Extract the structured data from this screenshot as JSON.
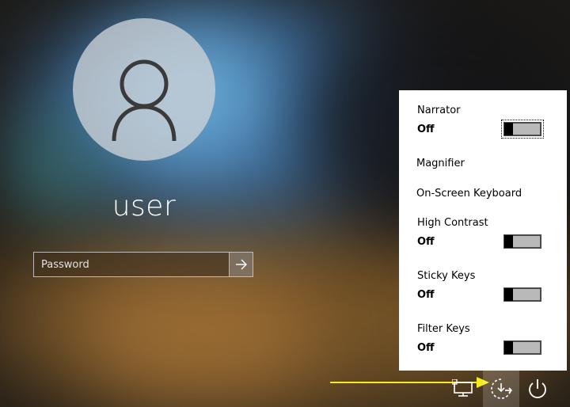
{
  "login": {
    "user_name": "user",
    "password_placeholder": "Password"
  },
  "ease_panel": {
    "items": [
      {
        "label": "Narrator",
        "state": "Off",
        "enabled": false
      },
      {
        "label": "Magnifier"
      },
      {
        "label": "On-Screen Keyboard"
      },
      {
        "label": "High Contrast",
        "state": "Off",
        "enabled": false
      },
      {
        "label": "Sticky Keys",
        "state": "Off",
        "enabled": false
      },
      {
        "label": "Filter Keys",
        "state": "Off",
        "enabled": false
      }
    ]
  },
  "tray": {
    "icons": [
      "network-icon",
      "ease-of-access-icon",
      "power-icon"
    ]
  },
  "colors": {
    "annotation_arrow": "#f7ec1a",
    "panel_background": "#ffffff",
    "toggle_track": "#b9b9b9"
  }
}
